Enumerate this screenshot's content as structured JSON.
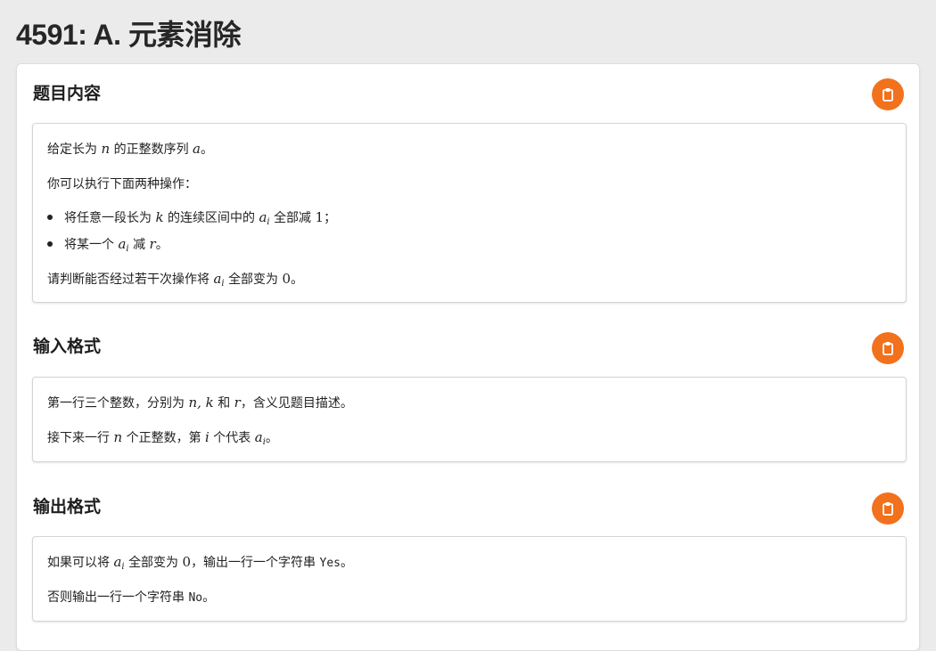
{
  "page": {
    "title": "4591: A. 元素消除"
  },
  "colors": {
    "accent": "#f2711c",
    "background": "#ebebeb"
  },
  "sections": [
    {
      "heading": "题目内容",
      "copy_icon": "clipboard-icon",
      "p1": {
        "a": "给定长为",
        "n": "n",
        "b": "的正整数序列",
        "a_var": "a",
        "c": "。"
      },
      "p2": "你可以执行下面两种操作：",
      "li1": {
        "a": "将任意一段长为",
        "k": "k",
        "b": "的连续区间中的",
        "ai_base": "a",
        "ai_sub": "i",
        "c": "全部减",
        "one": "1",
        "d": "；"
      },
      "li2": {
        "a": "将某一个",
        "ai_base": "a",
        "ai_sub": "i",
        "b": "减",
        "r": "r",
        "c": "。"
      },
      "p3": {
        "a": "请判断能否经过若干次操作将",
        "ai_base": "a",
        "ai_sub": "i",
        "b": "全部变为",
        "zero": "0",
        "c": "。"
      }
    },
    {
      "heading": "输入格式",
      "copy_icon": "clipboard-icon",
      "p1": {
        "a": "第一行三个整数，分别为",
        "nk": "n, k",
        "b": "和",
        "r": "r",
        "c": "，含义见题目描述。"
      },
      "p2": {
        "a": "接下来一行",
        "n": "n",
        "b": "个正整数，第",
        "i": "i",
        "c": "个代表",
        "ai_base": "a",
        "ai_sub": "i",
        "d": "。"
      }
    },
    {
      "heading": "输出格式",
      "copy_icon": "clipboard-icon",
      "p1": {
        "a": "如果可以将",
        "ai_base": "a",
        "ai_sub": "i",
        "b": "全部变为",
        "zero": "0",
        "c": "，输出一行一个字符串",
        "yes": "Yes",
        "d": "。"
      },
      "p2": {
        "a": "否则输出一行一个字符串",
        "no": "No",
        "b": "。"
      }
    }
  ]
}
